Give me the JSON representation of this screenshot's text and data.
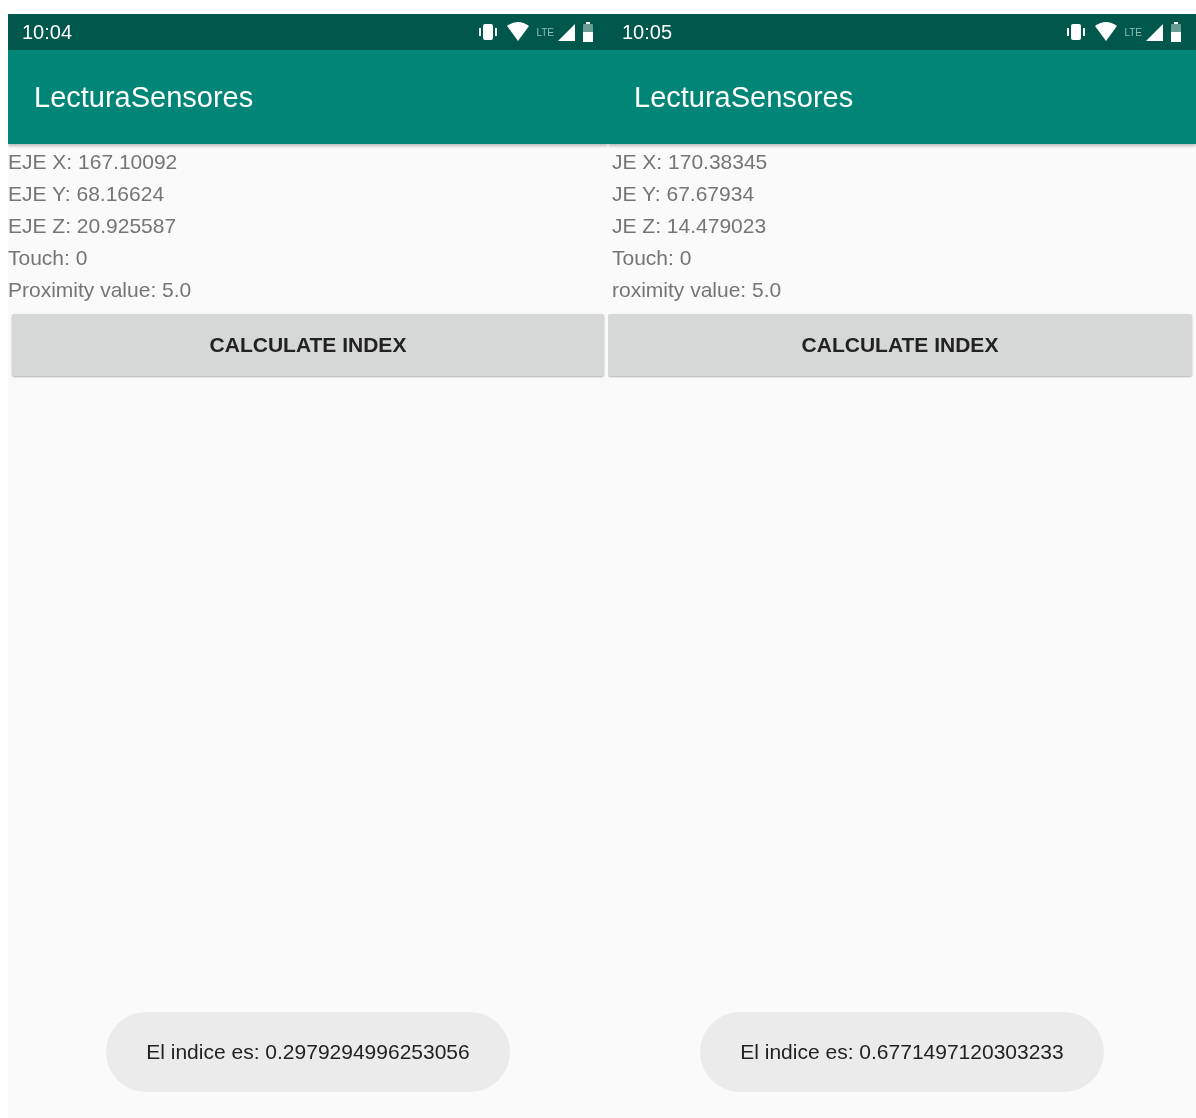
{
  "screens": [
    {
      "status_bar": {
        "time": "10:04",
        "network_label": "LTE"
      },
      "app_bar": {
        "title": "LecturaSensores"
      },
      "readings": [
        "EJE X: 167.10092",
        "EJE Y: 68.16624",
        "EJE Z: 20.925587",
        "Touch: 0",
        "Proximity value: 5.0"
      ],
      "button": "CALCULATE INDEX",
      "toast": "El indice es: 0.2979294996253056"
    },
    {
      "status_bar": {
        "time": "10:05",
        "network_label": "LTE"
      },
      "app_bar": {
        "title": "LecturaSensores"
      },
      "readings": [
        "JE X: 170.38345",
        "JE Y: 67.67934",
        "JE Z: 14.479023",
        "Touch: 0",
        "roximity value: 5.0"
      ],
      "button": "CALCULATE INDEX",
      "toast": "El indice es: 0.6771497120303233"
    }
  ]
}
